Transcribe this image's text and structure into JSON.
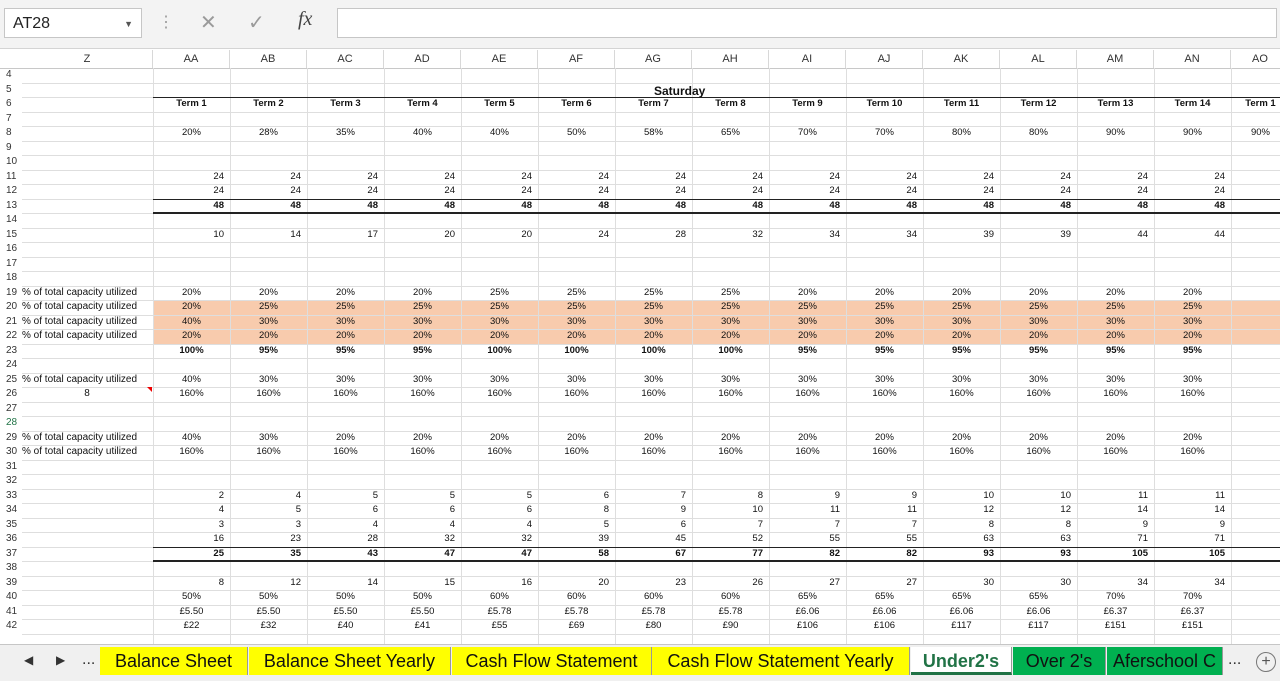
{
  "formula_bar": {
    "name_box": "AT28",
    "cancel_glyph": "✕",
    "enter_glyph": "✓",
    "fx_label": "fx",
    "formula": ""
  },
  "columns": [
    "Z",
    "AA",
    "AB",
    "AC",
    "AD",
    "AE",
    "AF",
    "AG",
    "AH",
    "AI",
    "AJ",
    "AK",
    "AL",
    "AM",
    "AN",
    "AO"
  ],
  "rows": [
    "4",
    "5",
    "6",
    "7",
    "8",
    "9",
    "10",
    "11",
    "12",
    "13",
    "14",
    "15",
    "16",
    "17",
    "18",
    "19",
    "20",
    "21",
    "22",
    "23",
    "24",
    "25",
    "26",
    "27",
    "28",
    "29",
    "30",
    "31",
    "32",
    "33",
    "34",
    "35",
    "36",
    "37",
    "38",
    "39",
    "40",
    "41",
    "42"
  ],
  "selected_row": "28",
  "header_title": "Saturday",
  "terms": [
    "Term 1",
    "Term 2",
    "Term 3",
    "Term 4",
    "Term 5",
    "Term 6",
    "Term 7",
    "Term 8",
    "Term 9",
    "Term 10",
    "Term 11",
    "Term 12",
    "Term 13",
    "Term 14",
    "Term 1"
  ],
  "row_labels": {
    "r19": "% of total capacity utilized",
    "r20": "% of total capacity utilized",
    "r21": "% of total capacity utilized",
    "r22": "% of total capacity utilized",
    "r25": "% of total capacity utilized",
    "r26": "8",
    "r29": "% of total capacity utilized",
    "r30": "% of total capacity utilized"
  },
  "table": {
    "r8": [
      "20%",
      "28%",
      "35%",
      "40%",
      "40%",
      "50%",
      "58%",
      "65%",
      "70%",
      "70%",
      "80%",
      "80%",
      "90%",
      "90%",
      "90%"
    ],
    "r11": [
      "24",
      "24",
      "24",
      "24",
      "24",
      "24",
      "24",
      "24",
      "24",
      "24",
      "24",
      "24",
      "24",
      "24",
      ""
    ],
    "r12": [
      "24",
      "24",
      "24",
      "24",
      "24",
      "24",
      "24",
      "24",
      "24",
      "24",
      "24",
      "24",
      "24",
      "24",
      ""
    ],
    "r13": [
      "48",
      "48",
      "48",
      "48",
      "48",
      "48",
      "48",
      "48",
      "48",
      "48",
      "48",
      "48",
      "48",
      "48",
      ""
    ],
    "r15": [
      "10",
      "14",
      "17",
      "20",
      "20",
      "24",
      "28",
      "32",
      "34",
      "34",
      "39",
      "39",
      "44",
      "44",
      ""
    ],
    "r19": [
      "20%",
      "20%",
      "20%",
      "20%",
      "25%",
      "25%",
      "25%",
      "25%",
      "20%",
      "20%",
      "20%",
      "20%",
      "20%",
      "20%",
      ""
    ],
    "r20": [
      "20%",
      "25%",
      "25%",
      "25%",
      "25%",
      "25%",
      "25%",
      "25%",
      "25%",
      "25%",
      "25%",
      "25%",
      "25%",
      "25%",
      ""
    ],
    "r21": [
      "40%",
      "30%",
      "30%",
      "30%",
      "30%",
      "30%",
      "30%",
      "30%",
      "30%",
      "30%",
      "30%",
      "30%",
      "30%",
      "30%",
      ""
    ],
    "r22": [
      "20%",
      "20%",
      "20%",
      "20%",
      "20%",
      "20%",
      "20%",
      "20%",
      "20%",
      "20%",
      "20%",
      "20%",
      "20%",
      "20%",
      ""
    ],
    "r23": [
      "100%",
      "95%",
      "95%",
      "95%",
      "100%",
      "100%",
      "100%",
      "100%",
      "95%",
      "95%",
      "95%",
      "95%",
      "95%",
      "95%",
      ""
    ],
    "r25": [
      "40%",
      "30%",
      "30%",
      "30%",
      "30%",
      "30%",
      "30%",
      "30%",
      "30%",
      "30%",
      "30%",
      "30%",
      "30%",
      "30%",
      ""
    ],
    "r26": [
      "160%",
      "160%",
      "160%",
      "160%",
      "160%",
      "160%",
      "160%",
      "160%",
      "160%",
      "160%",
      "160%",
      "160%",
      "160%",
      "160%",
      ""
    ],
    "r29": [
      "40%",
      "30%",
      "20%",
      "20%",
      "20%",
      "20%",
      "20%",
      "20%",
      "20%",
      "20%",
      "20%",
      "20%",
      "20%",
      "20%",
      ""
    ],
    "r30": [
      "160%",
      "160%",
      "160%",
      "160%",
      "160%",
      "160%",
      "160%",
      "160%",
      "160%",
      "160%",
      "160%",
      "160%",
      "160%",
      "160%",
      ""
    ],
    "r33": [
      "2",
      "4",
      "5",
      "5",
      "5",
      "6",
      "7",
      "8",
      "9",
      "9",
      "10",
      "10",
      "11",
      "11",
      ""
    ],
    "r34": [
      "4",
      "5",
      "6",
      "6",
      "6",
      "8",
      "9",
      "10",
      "11",
      "11",
      "12",
      "12",
      "14",
      "14",
      ""
    ],
    "r35": [
      "3",
      "3",
      "4",
      "4",
      "4",
      "5",
      "6",
      "7",
      "7",
      "7",
      "8",
      "8",
      "9",
      "9",
      ""
    ],
    "r36": [
      "16",
      "23",
      "28",
      "32",
      "32",
      "39",
      "45",
      "52",
      "55",
      "55",
      "63",
      "63",
      "71",
      "71",
      ""
    ],
    "r37": [
      "25",
      "35",
      "43",
      "47",
      "47",
      "58",
      "67",
      "77",
      "82",
      "82",
      "93",
      "93",
      "105",
      "105",
      ""
    ],
    "r39": [
      "8",
      "12",
      "14",
      "15",
      "16",
      "20",
      "23",
      "26",
      "27",
      "27",
      "30",
      "30",
      "34",
      "34",
      ""
    ],
    "r40": [
      "50%",
      "50%",
      "50%",
      "50%",
      "60%",
      "60%",
      "60%",
      "60%",
      "65%",
      "65%",
      "65%",
      "65%",
      "70%",
      "70%",
      ""
    ],
    "r41": [
      "£5.50",
      "£5.50",
      "£5.50",
      "£5.50",
      "£5.78",
      "£5.78",
      "£5.78",
      "£5.78",
      "£6.06",
      "£6.06",
      "£6.06",
      "£6.06",
      "£6.37",
      "£6.37",
      ""
    ],
    "r42": [
      "£22",
      "£32",
      "£40",
      "£41",
      "£55",
      "£69",
      "£80",
      "£90",
      "£106",
      "£106",
      "£117",
      "£117",
      "£151",
      "£151",
      ""
    ]
  },
  "sheet_tabs": [
    {
      "label": "Balance Sheet",
      "style": "yellow"
    },
    {
      "label": "Balance Sheet Yearly",
      "style": "yellow"
    },
    {
      "label": "Cash Flow Statement",
      "style": "yellow"
    },
    {
      "label": "Cash Flow Statement Yearly",
      "style": "yellow"
    },
    {
      "label": "Under2's",
      "style": "active"
    },
    {
      "label": "Over 2's",
      "style": "green"
    },
    {
      "label": "Aferschool C",
      "style": "green"
    }
  ],
  "tab_nav": {
    "prev": "◀",
    "next": "▶",
    "dots": "...",
    "more": "...",
    "add": "+"
  },
  "colors": {
    "highlight": "#f8cbad",
    "yellow_tab": "#ffff00",
    "green_tab": "#00b050",
    "active_tab_text": "#217346"
  }
}
